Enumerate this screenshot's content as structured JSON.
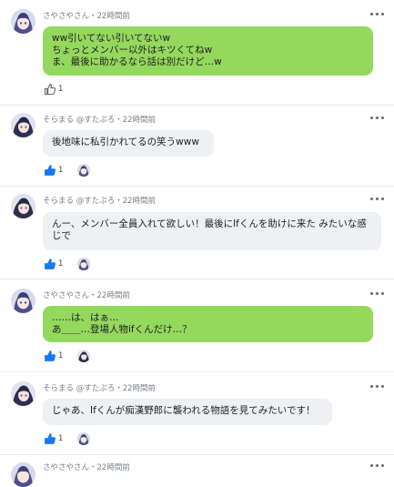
{
  "colors": {
    "my_bubble": "#95d85e",
    "other_bubble": "#eef0f3",
    "like_active": "#1877f2",
    "like_inactive": "#606770"
  },
  "icons": {
    "more": "more-horizontal-icon",
    "like": "thumbs-up-icon",
    "avatar": "anime-character-avatar"
  },
  "comments": [
    {
      "meta": "さやさやさん・22時間前",
      "lines": [
        "ww引いてない引いてないw",
        "ちょっとメンバー以外はキツくてねw",
        "ま、最後に助かるなら話は別だけど…w"
      ],
      "likes": "1",
      "liked": false
    },
    {
      "meta": "そらまる @すたぷろ・22時間前",
      "lines": [
        "後地味に私引かれてるの笑うwww"
      ],
      "likes": "1",
      "liked": true
    },
    {
      "meta": "そらまる @すたぷろ・22時間前",
      "lines": [
        "んー、メンバー全員入れて欲しい！最後にIfくんを助けに来た みたいな感",
        "じで"
      ],
      "likes": "1",
      "liked": true
    },
    {
      "meta": "さやさやさん・22時間前",
      "lines": [
        "……は、はぁ…",
        "あ＿＿…登場人物ifくんだけ…？"
      ],
      "likes": "1",
      "liked": true
    },
    {
      "meta": "そらまる @すたぷろ・22時間前",
      "lines": [
        "じゃあ、Ifくんが痴漢野郎に襲われる物語を見てみたいです！"
      ],
      "likes": "1",
      "liked": true
    },
    {
      "meta": "さやさやさん・22時間前",
      "lines": [],
      "likes": "",
      "liked": false
    }
  ]
}
